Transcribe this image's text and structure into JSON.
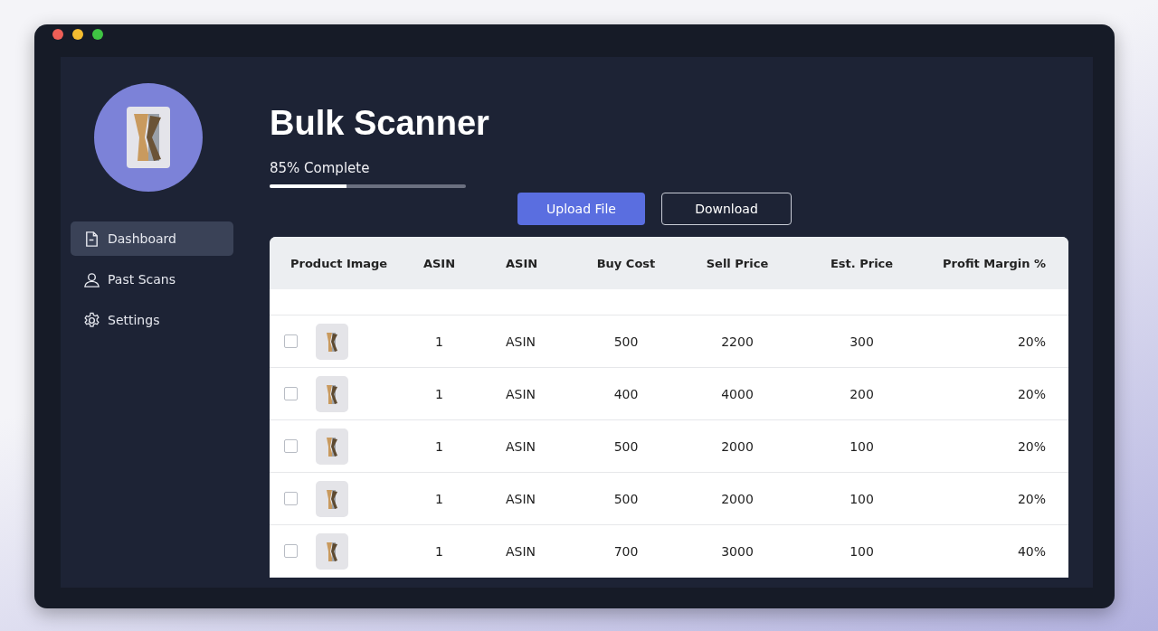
{
  "sidebar": {
    "items": [
      {
        "label": "Dashboard",
        "selected": true
      },
      {
        "label": "Past Scans",
        "selected": false
      },
      {
        "label": "Settings",
        "selected": false
      }
    ]
  },
  "title": "Bulk Scanner",
  "progress": {
    "label": "85% Complete",
    "level": 0.39
  },
  "buttons": [
    {
      "label": "Upload File",
      "kind": "primary"
    },
    {
      "label": "Download",
      "kind": "outline"
    }
  ],
  "table": {
    "columns": [
      "Product Image",
      "ASIN",
      "ASIN",
      "Buy Cost",
      "Sell Price",
      "Est. Price",
      "Profit Margin %"
    ],
    "rows": [
      {
        "checked": false,
        "cells": [
          "",
          "1",
          "ASIN",
          "500",
          "2200",
          "300",
          "20%"
        ]
      },
      {
        "checked": false,
        "cells": [
          "",
          "1",
          "ASIN",
          "400",
          "4000",
          "200",
          "20%"
        ]
      },
      {
        "checked": false,
        "cells": [
          "",
          "1",
          "ASIN",
          "500",
          "2000",
          "100",
          "20%"
        ]
      },
      {
        "checked": false,
        "cells": [
          "",
          "1",
          "ASIN",
          "500",
          "2000",
          "100",
          "20%"
        ]
      },
      {
        "checked": false,
        "cells": [
          "",
          "1",
          "ASIN",
          "700",
          "3000",
          "100",
          "40%"
        ]
      }
    ]
  }
}
